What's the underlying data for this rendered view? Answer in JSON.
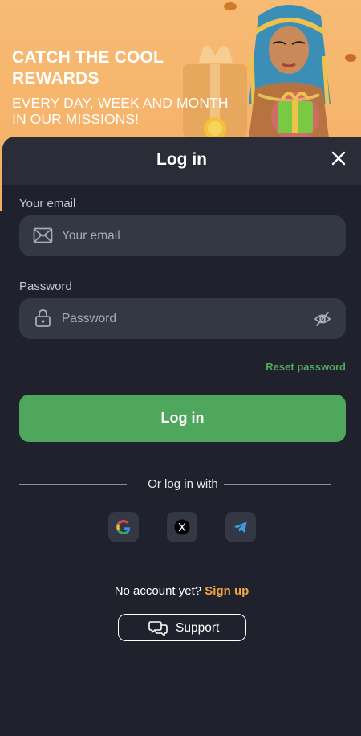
{
  "banner": {
    "headline_line1": "CATCH THE COOL",
    "headline_line2": "REWARDS",
    "sub_line1": "EVERY DAY, WEEK AND MONTH",
    "sub_line2": "IN OUR MISSIONS!"
  },
  "login": {
    "title": "Log in",
    "email_label": "Your email",
    "email_placeholder": "Your email",
    "email_value": "",
    "password_label": "Password",
    "password_placeholder": "Password",
    "password_value": "",
    "reset_link": "Reset password",
    "submit_label": "Log in",
    "social_divider": "Or log in with",
    "social": [
      "google-icon",
      "x-icon",
      "telegram-icon"
    ],
    "signup_prompt": "No account yet?",
    "signup_link": "Sign up",
    "support_label": "Support"
  },
  "icons": {
    "close": "close-icon",
    "email": "envelope-icon",
    "password": "lock-icon",
    "visibility": "eye-off-icon",
    "support": "chat-bubbles-icon"
  },
  "colors": {
    "banner_bg": "#f6b46b",
    "sheet_bg": "#1f222c",
    "header_bg": "#2a2d38",
    "field_bg": "#343845",
    "accent_green": "#4ea75c",
    "link_green": "#53a860",
    "signup_orange": "#f1a63f"
  }
}
